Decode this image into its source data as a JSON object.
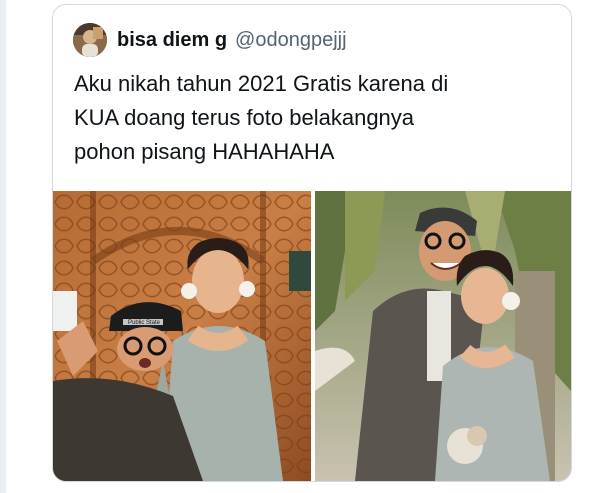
{
  "tweet": {
    "author_name": "bisa diem g",
    "author_handle": "@odongpejjj",
    "text_lines": [
      "Aku nikah tahun 2021 Gratis karena di",
      "KUA doang terus foto belakangnya",
      "pohon pisang HAHAHAHA"
    ]
  },
  "photos": [
    {
      "name": "photo-wedding-couple-carved-wall",
      "cap_text": "Public State"
    },
    {
      "name": "photo-wedding-couple-banana-tree"
    }
  ],
  "colors": {
    "text": "#0f1419",
    "secondary_text": "#536471",
    "border": "#cfd9de"
  }
}
